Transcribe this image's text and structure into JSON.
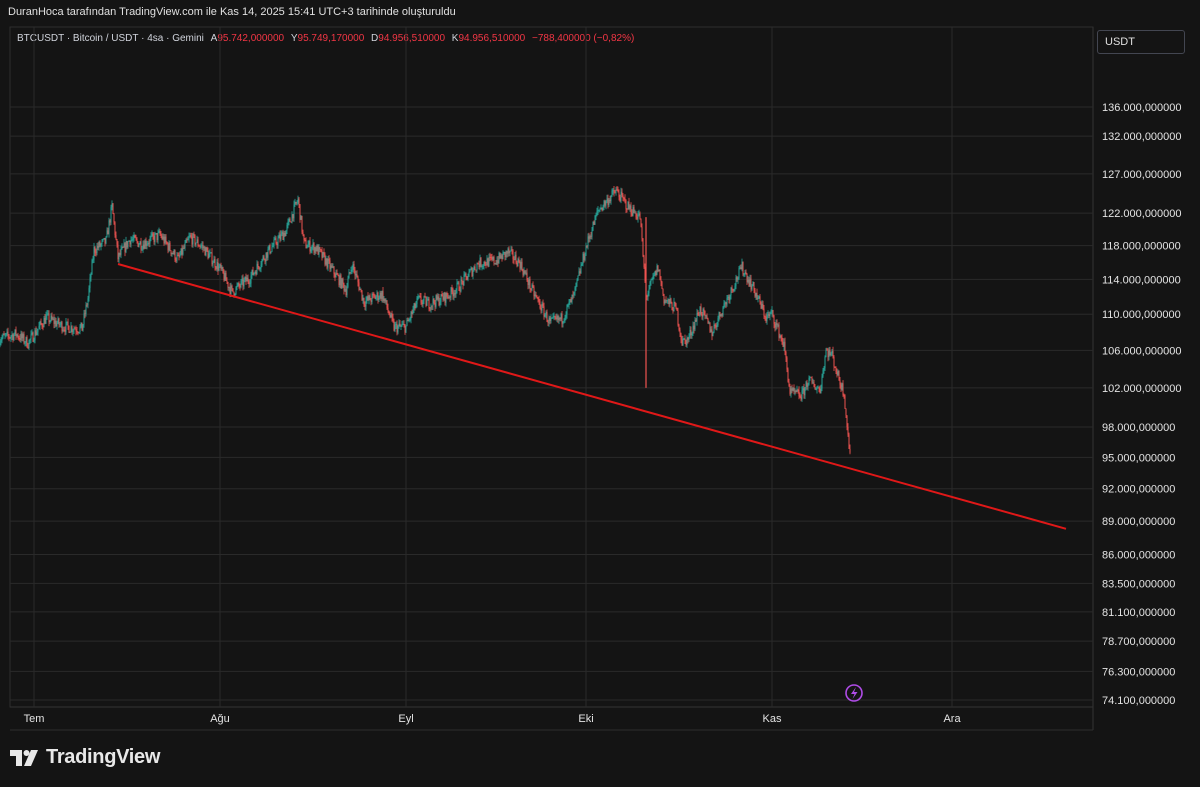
{
  "header": {
    "caption": "DuranHoca tarafından TradingView.com ile Kas 14, 2025 15:41 UTC+3 tarihinde oluşturuldu"
  },
  "legend": {
    "symbol": "BTCUSDT · Bitcoin / USDT · 4sa · Gemini",
    "open_label": "A",
    "open_value": "95.742,000000",
    "high_label": "Y",
    "high_value": "95.749,170000",
    "low_label": "D",
    "low_value": "94.956,510000",
    "close_label": "K",
    "close_value": "94.956,510000",
    "change": "−788,400000 (−0,82%)"
  },
  "currency_button": "USDT",
  "brand": {
    "name": "TradingView",
    "logo_icon": "tradingview-logo-icon"
  },
  "colors": {
    "background": "#141414",
    "up": "#26a69a",
    "down": "#ef5350",
    "trendline": "#e01818",
    "grid": "#2a2a2a"
  },
  "chart_data": {
    "type": "candlestick",
    "title": "BTCUSDT · Bitcoin / USDT · 4sa · Gemini",
    "y_axis": {
      "scale": "log",
      "ticks": [
        {
          "value": 136000,
          "label": "136.000,000000"
        },
        {
          "value": 132000,
          "label": "132.000,000000"
        },
        {
          "value": 127000,
          "label": "127.000,000000"
        },
        {
          "value": 122000,
          "label": "122.000,000000"
        },
        {
          "value": 118000,
          "label": "118.000,000000"
        },
        {
          "value": 114000,
          "label": "114.000,000000"
        },
        {
          "value": 110000,
          "label": "110.000,000000"
        },
        {
          "value": 106000,
          "label": "106.000,000000"
        },
        {
          "value": 102000,
          "label": "102.000,000000"
        },
        {
          "value": 98000,
          "label": "98.000,000000"
        },
        {
          "value": 95000,
          "label": "95.000,000000"
        },
        {
          "value": 92000,
          "label": "92.000,000000"
        },
        {
          "value": 89000,
          "label": "89.000,000000"
        },
        {
          "value": 86000,
          "label": "86.000,000000"
        },
        {
          "value": 83500,
          "label": "83.500,000000"
        },
        {
          "value": 81100,
          "label": "81.100,000000"
        },
        {
          "value": 78700,
          "label": "78.700,000000"
        },
        {
          "value": 76300,
          "label": "76.300,000000"
        },
        {
          "value": 74100,
          "label": "74.100,000000"
        }
      ]
    },
    "x_axis": {
      "ticks": [
        {
          "date": "2025-07-01",
          "label": "Tem"
        },
        {
          "date": "2025-08-01",
          "label": "Ağu"
        },
        {
          "date": "2025-09-01",
          "label": "Eyl"
        },
        {
          "date": "2025-10-01",
          "label": "Eki"
        },
        {
          "date": "2025-11-01",
          "label": "Kas"
        },
        {
          "date": "2025-12-01",
          "label": "Ara"
        }
      ]
    },
    "price_path": [
      [
        "2025-06-25",
        107200
      ],
      [
        "2025-06-28",
        107800
      ],
      [
        "2025-06-30",
        106800
      ],
      [
        "2025-07-03",
        109600
      ],
      [
        "2025-07-06",
        108600
      ],
      [
        "2025-07-09",
        108400
      ],
      [
        "2025-07-10",
        111800
      ],
      [
        "2025-07-11",
        117500
      ],
      [
        "2025-07-13",
        118500
      ],
      [
        "2025-07-14",
        122800
      ],
      [
        "2025-07-15",
        116500
      ],
      [
        "2025-07-17",
        118800
      ],
      [
        "2025-07-19",
        118200
      ],
      [
        "2025-07-22",
        119300
      ],
      [
        "2025-07-25",
        116300
      ],
      [
        "2025-07-27",
        119000
      ],
      [
        "2025-07-29",
        117900
      ],
      [
        "2025-08-01",
        115200
      ],
      [
        "2025-08-03",
        112500
      ],
      [
        "2025-08-06",
        114200
      ],
      [
        "2025-08-09",
        117300
      ],
      [
        "2025-08-12",
        119800
      ],
      [
        "2025-08-14",
        123700
      ],
      [
        "2025-08-15",
        118200
      ],
      [
        "2025-08-17",
        117700
      ],
      [
        "2025-08-19",
        115800
      ],
      [
        "2025-08-22",
        112800
      ],
      [
        "2025-08-23",
        115800
      ],
      [
        "2025-08-25",
        111400
      ],
      [
        "2025-08-28",
        112300
      ],
      [
        "2025-08-30",
        108500
      ],
      [
        "2025-09-01",
        108600
      ],
      [
        "2025-09-03",
        111600
      ],
      [
        "2025-09-05",
        111200
      ],
      [
        "2025-09-08",
        112100
      ],
      [
        "2025-09-10",
        113300
      ],
      [
        "2025-09-13",
        115900
      ],
      [
        "2025-09-16",
        116200
      ],
      [
        "2025-09-18",
        117200
      ],
      [
        "2025-09-20",
        115900
      ],
      [
        "2025-09-22",
        112700
      ],
      [
        "2025-09-25",
        109000
      ],
      [
        "2025-09-27",
        109500
      ],
      [
        "2025-09-29",
        112100
      ],
      [
        "2025-10-01",
        117800
      ],
      [
        "2025-10-03",
        122300
      ],
      [
        "2025-10-06",
        124800
      ],
      [
        "2025-10-08",
        122800
      ],
      [
        "2025-10-10",
        121500
      ],
      [
        "2025-10-11",
        112000
      ],
      [
        "2025-10-13",
        115400
      ],
      [
        "2025-10-14",
        111700
      ],
      [
        "2025-10-16",
        110600
      ],
      [
        "2025-10-17",
        106900
      ],
      [
        "2025-10-18",
        107200
      ],
      [
        "2025-10-20",
        110600
      ],
      [
        "2025-10-22",
        108000
      ],
      [
        "2025-10-24",
        111000
      ],
      [
        "2025-10-27",
        115400
      ],
      [
        "2025-10-29",
        112800
      ],
      [
        "2025-10-31",
        109600
      ],
      [
        "2025-11-01",
        110000
      ],
      [
        "2025-11-03",
        106500
      ],
      [
        "2025-11-04",
        101500
      ],
      [
        "2025-11-06",
        101200
      ],
      [
        "2025-11-07",
        102800
      ],
      [
        "2025-11-09",
        101800
      ],
      [
        "2025-11-10",
        106000
      ],
      [
        "2025-11-11",
        105500
      ],
      [
        "2025-11-12",
        103200
      ],
      [
        "2025-11-13",
        101500
      ],
      [
        "2025-11-14",
        94956.51
      ]
    ],
    "spikes": [
      {
        "date": "2025-10-10",
        "low": 102000
      }
    ],
    "trendline": {
      "start": {
        "date": "2025-07-15",
        "value": 115800
      },
      "end": {
        "date": "2025-12-20",
        "value": 88300
      }
    },
    "last_close": 94956.51,
    "grid": true
  }
}
